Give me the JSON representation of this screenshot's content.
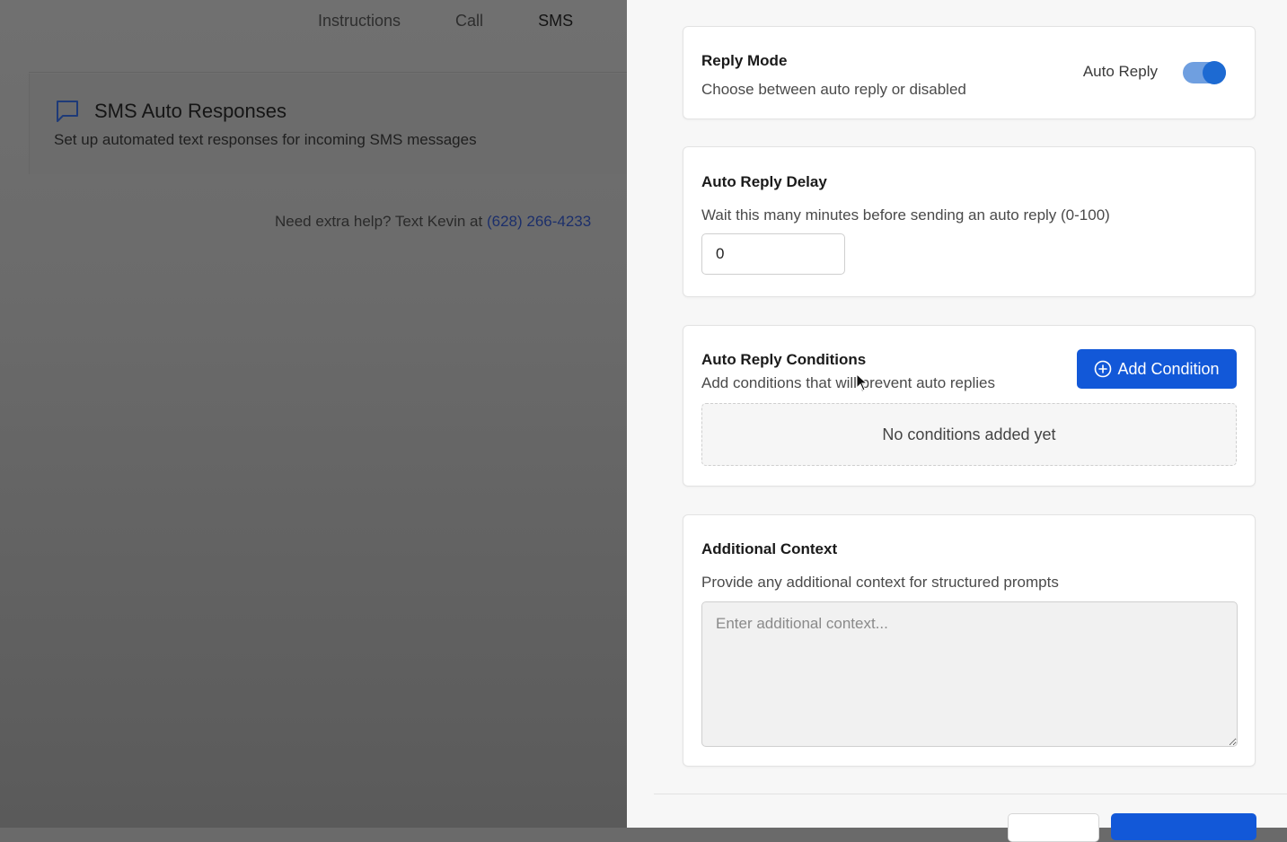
{
  "background": {
    "tabs": [
      {
        "label": "Instructions",
        "active": false
      },
      {
        "label": "Call",
        "active": false
      },
      {
        "label": "SMS",
        "active": true
      }
    ],
    "card": {
      "icon": "chat-bubble-icon",
      "title": "SMS Auto Responses",
      "subtitle": "Set up automated text responses for incoming SMS messages"
    },
    "help": {
      "text": "Need extra help? Text Kevin at ",
      "phone": "(628) 266-4233"
    }
  },
  "panel": {
    "reply_mode": {
      "title": "Reply Mode",
      "description": "Choose between auto reply or disabled",
      "toggle_label": "Auto Reply",
      "toggle_on": true
    },
    "delay": {
      "title": "Auto Reply Delay",
      "description": "Wait this many minutes before sending an auto reply (0-100)",
      "value": "0"
    },
    "conditions": {
      "title": "Auto Reply Conditions",
      "description": "Add conditions that will prevent auto replies",
      "add_button_label": "Add Condition",
      "add_button_icon": "plus-circle-icon",
      "empty_text": "No conditions added yet"
    },
    "context": {
      "title": "Additional Context",
      "description": "Provide any additional context for structured prompts",
      "placeholder": "Enter additional context..."
    }
  },
  "colors": {
    "accent": "#1258d8",
    "toggle_track": "#6f9fe0",
    "overlay": "#6a6a6a"
  }
}
